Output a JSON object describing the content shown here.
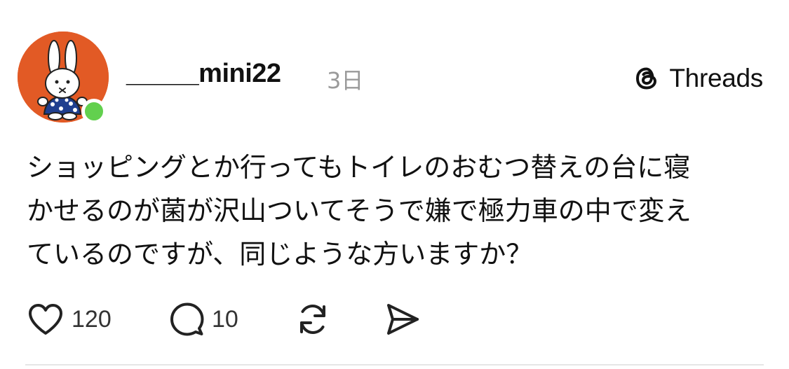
{
  "post": {
    "author": {
      "username": "_____mini22",
      "online": true,
      "avatar_icon": "bunny-avatar-icon"
    },
    "posted_ago": "3日",
    "brand": {
      "name": "Threads",
      "logo_icon": "threads-logo-icon"
    },
    "text_lines": [
      "ショッピングとか行ってもトイレのおむつ替えの台に寝",
      "かせるのが菌が沢山ついてそうで嫌で極力車の中で変え",
      "ているのですが、同じような方いますか？"
    ],
    "actions": {
      "like": {
        "icon": "heart-icon",
        "count": "120"
      },
      "reply": {
        "icon": "comment-icon",
        "count": "10"
      },
      "repost": {
        "icon": "repost-icon"
      },
      "share": {
        "icon": "send-icon"
      }
    }
  },
  "colors": {
    "avatar_background": "#e25a25",
    "online_indicator": "#62d04e",
    "secondary_text": "#9a9a9a"
  }
}
